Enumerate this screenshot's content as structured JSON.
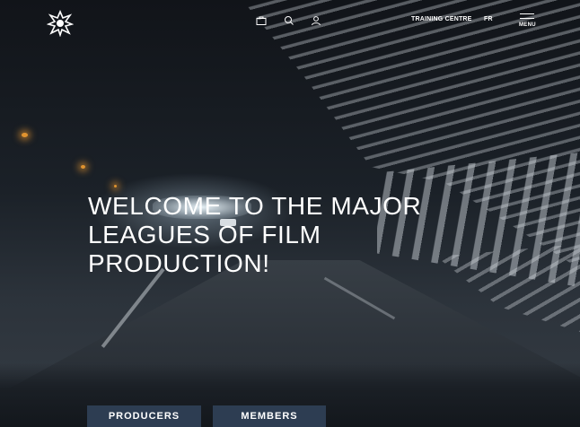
{
  "header": {
    "logo_name": "union-emblem",
    "icons": [
      "briefcase-icon",
      "search-icon",
      "user-icon"
    ],
    "training_label": "TRAINING CENTRE",
    "lang_label": "FR",
    "menu_label": "MENU"
  },
  "hero": {
    "headline": "WELCOME TO THE MAJOR LEAGUES OF FILM PRODUCTION!"
  },
  "cta": {
    "producers_label": "PRODUCERS",
    "members_label": "MEMBERS"
  },
  "colors": {
    "cta_bg": "#2d3d52",
    "text": "#ffffff"
  }
}
